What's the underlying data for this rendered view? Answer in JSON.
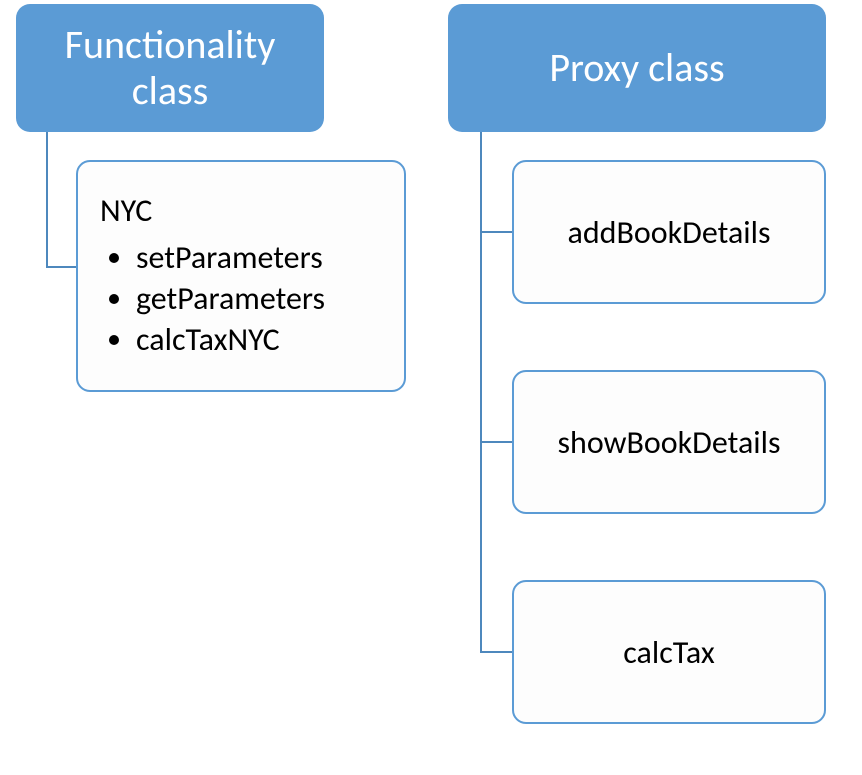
{
  "left": {
    "header": "Functionality class",
    "child": {
      "title": "NYC",
      "bullets": [
        "setParameters",
        "getParameters",
        "calcTaxNYC"
      ]
    }
  },
  "right": {
    "header": "Proxy class",
    "children": [
      "addBookDetails",
      "showBookDetails",
      "calcTax"
    ]
  }
}
